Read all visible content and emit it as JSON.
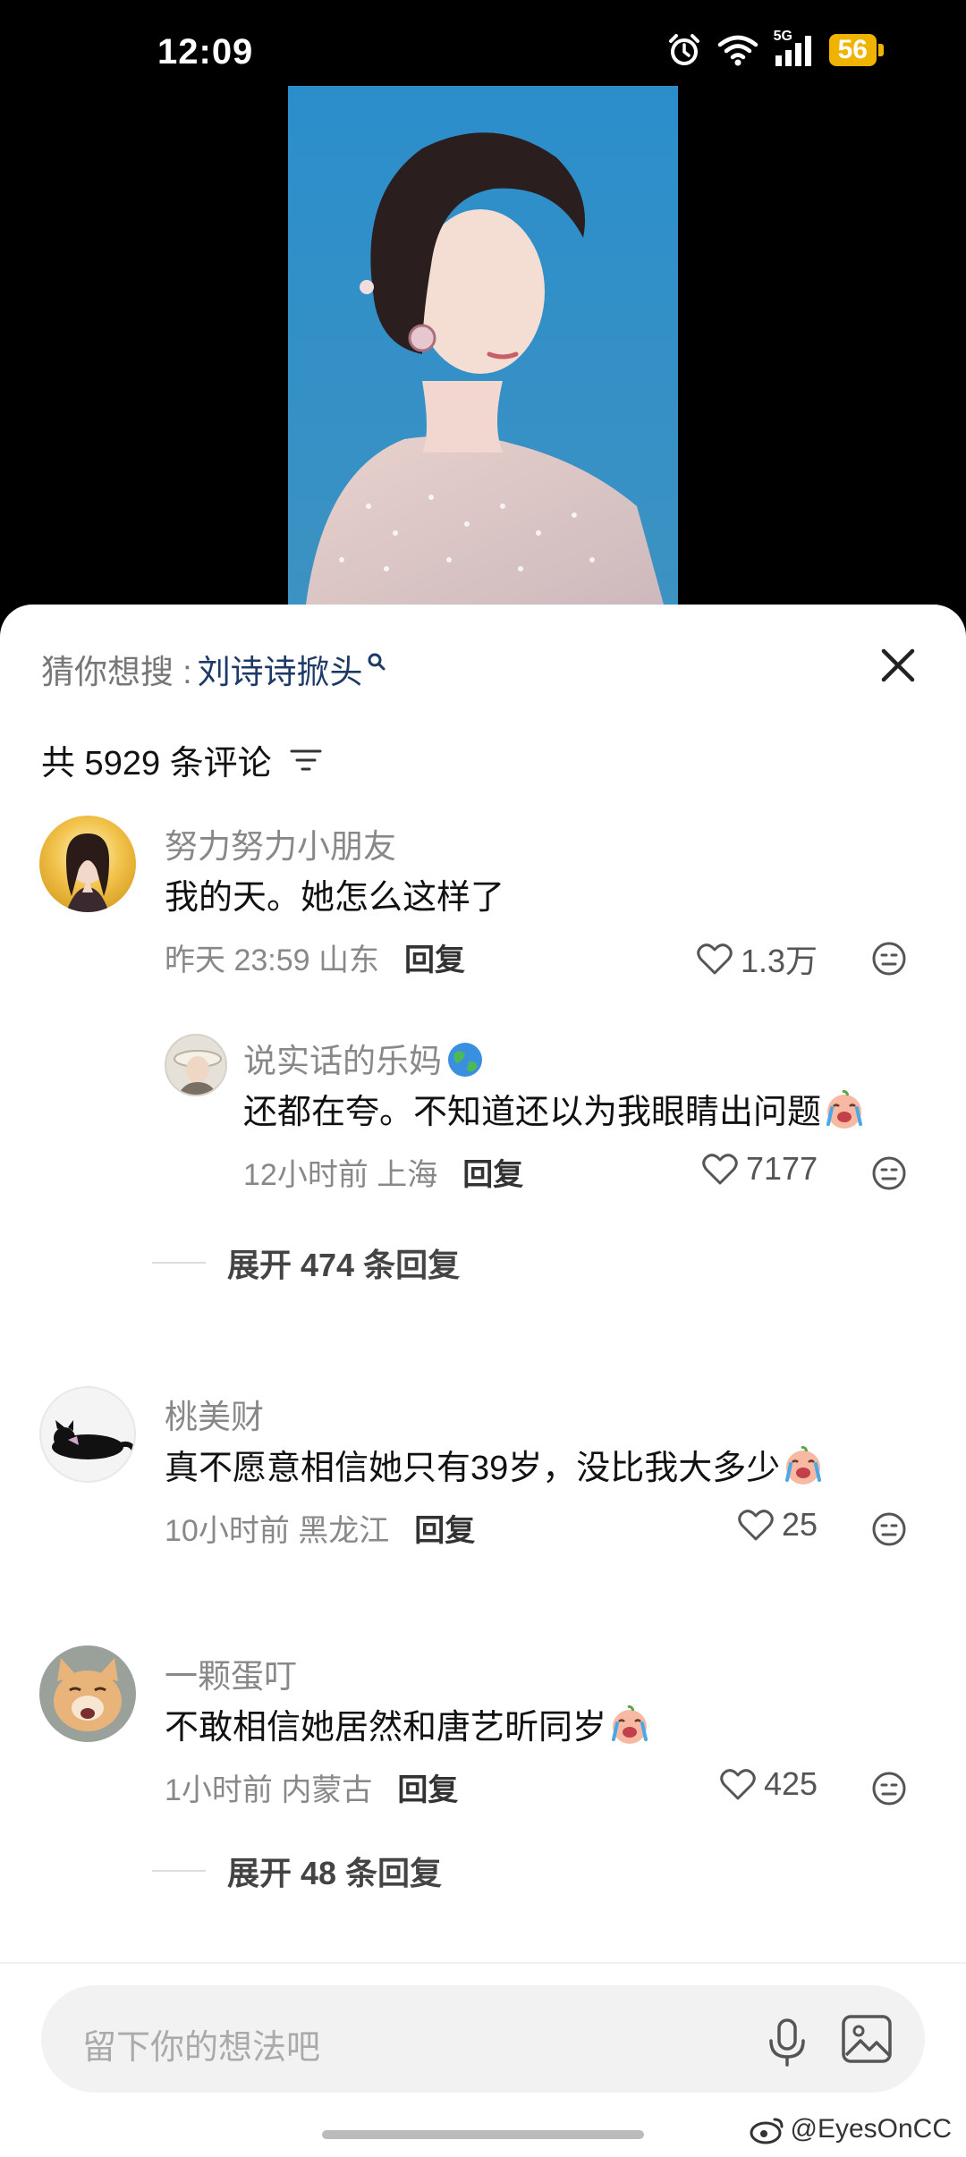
{
  "status_bar": {
    "time": "12:09",
    "signal_label": "5G",
    "battery": "56",
    "icons": [
      "alarm-icon",
      "wifi-icon",
      "signal-icon",
      "battery-icon"
    ]
  },
  "video": {
    "description_icon": "video-frame"
  },
  "search_suggest": {
    "prefix": "猜你想搜 : ",
    "keyword": "刘诗诗掀头"
  },
  "comments_header": {
    "count_text": "共 5929 条评论"
  },
  "comments": [
    {
      "name": "努力努力小朋友",
      "text": "我的天。她怎么这样了",
      "time_location": "昨天 23:59 山东",
      "reply_label": "回复",
      "likes": "1.3万",
      "replies": [
        {
          "name": "说实话的乐妈",
          "name_emoji": "🌏",
          "text": "还都在夸。不知道还以为我眼睛出问题",
          "time_location": "12小时前 上海",
          "reply_label": "回复",
          "likes": "7177"
        }
      ],
      "expand_text": "展开 474 条回复"
    },
    {
      "name": "桃美财",
      "text": "真不愿意相信她只有39岁，没比我大多少",
      "time_location": "10小时前 黑龙江",
      "reply_label": "回复",
      "likes": "25"
    },
    {
      "name": "一颗蛋叮",
      "text": "不敢相信她居然和唐艺昕同岁",
      "time_location": "1小时前 内蒙古",
      "reply_label": "回复",
      "likes": "425",
      "expand_text": "展开 48 条回复"
    }
  ],
  "input": {
    "placeholder": "留下你的想法吧"
  },
  "watermark": "@EyesOnCC",
  "colors": {
    "accent_keyword": "#1d3a66",
    "battery": "#f0b400",
    "video_bg": "#2a8fc8"
  }
}
